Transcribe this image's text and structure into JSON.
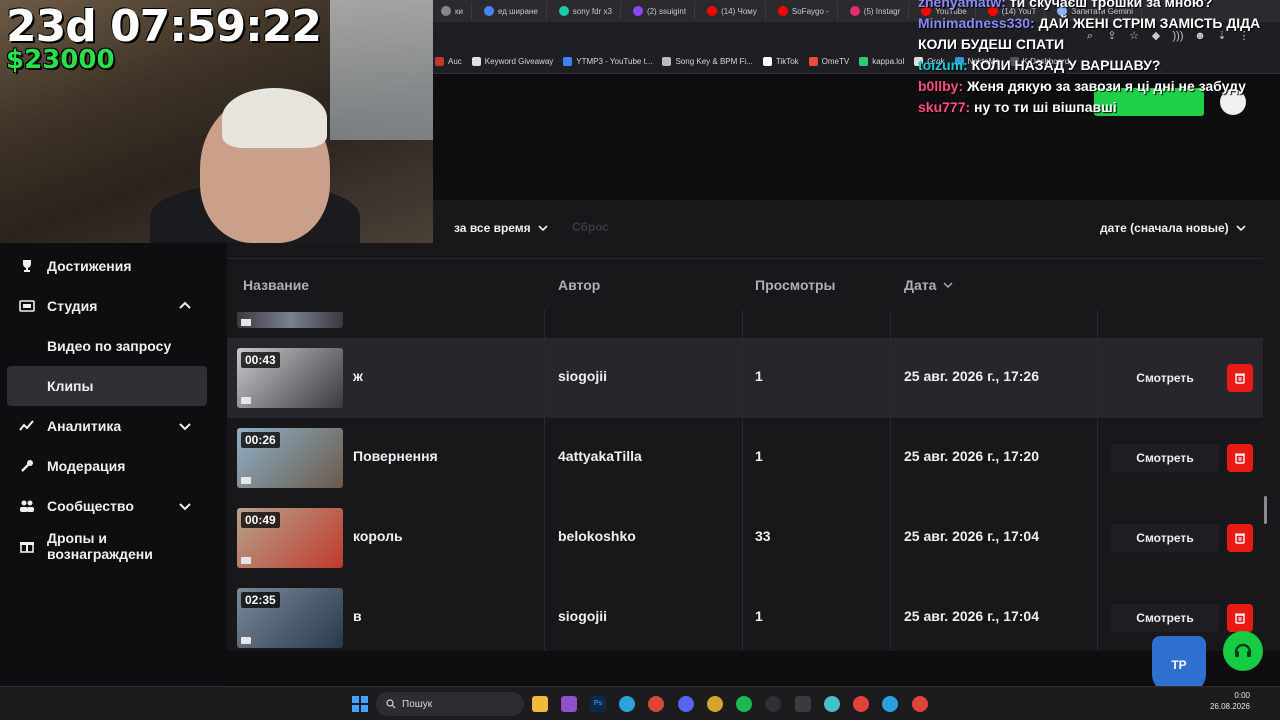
{
  "overlay": {
    "timer": "23d 07:59:22",
    "money": "$23000"
  },
  "browser": {
    "tabs": [
      {
        "label": "ки",
        "color": "#888888"
      },
      {
        "label": "ед ширане",
        "color": "#4285f4"
      },
      {
        "label": "sony fdr x3",
        "color": "#1dc8a8"
      },
      {
        "label": "(2) ssuigint",
        "color": "#9146ff"
      },
      {
        "label": "(14) Чому",
        "color": "#ff0000"
      },
      {
        "label": "SoFaygo -",
        "color": "#ff0000"
      },
      {
        "label": "(5) Instagr",
        "color": "#e1306c"
      },
      {
        "label": "YouTube",
        "color": "#ff0000"
      },
      {
        "label": "(14) YouT",
        "color": "#ff0000"
      },
      {
        "label": "Запитати Gemini",
        "color": "#8ab4f8"
      }
    ],
    "bookmarks": [
      {
        "label": "Auc",
        "color": "#c0392b"
      },
      {
        "label": "Keyword Giveaway",
        "color": "#e0e0e0"
      },
      {
        "label": "YTMP3 - YouTube t...",
        "color": "#3b82f6"
      },
      {
        "label": "Song Key & BPM Fi...",
        "color": "#bbbbbb"
      },
      {
        "label": "TikTok",
        "color": "#ffffff"
      },
      {
        "label": "OmeTV",
        "color": "#e74c3c"
      },
      {
        "label": "kappa.lol",
        "color": "#2ecc71"
      },
      {
        "label": "Grok",
        "color": "#dddddd"
      },
      {
        "label": "NektoMe",
        "color": "#3498db"
      },
      {
        "label": "K Dashboard",
        "color": "#555555"
      }
    ]
  },
  "chat": [
    {
      "user": "zhenyamatw:",
      "color": "#8a8aff",
      "message": "ти скучаєш трошки за мною?"
    },
    {
      "user": "Minimadness330:",
      "color": "#8a8aff",
      "message": "ДАЙ ЖЕНІ СТРІМ ЗАМІСТЬ ДІДА КОЛИ БУДЕШ СПАТИ"
    },
    {
      "user": "toizum:",
      "color": "#1ec8d6",
      "message": "КОЛИ НАЗАД У ВАРШАВУ?"
    },
    {
      "user": "b0llby:",
      "color": "#ff4f7a",
      "message": "Женя дякую за завози я ці дні не забуду"
    },
    {
      "user": "sku777:",
      "color": "#ff4f7a",
      "message": "ну то ти ші вішпавші"
    }
  ],
  "sidebar": {
    "items": [
      {
        "label": "Достижения",
        "icon": "trophy-icon"
      },
      {
        "label": "Студия",
        "icon": "film-icon",
        "expanded": true
      },
      {
        "label": "Видео по запросу",
        "sub": true
      },
      {
        "label": "Клипы",
        "sub": true,
        "active": true
      },
      {
        "label": "Аналитика",
        "icon": "chart-icon",
        "expanded": false
      },
      {
        "label": "Модерация",
        "icon": "wrench-icon"
      },
      {
        "label": "Сообщество",
        "icon": "people-icon",
        "expanded": false
      },
      {
        "label": "Дропы и вознаграждени",
        "icon": "gift-icon"
      }
    ]
  },
  "filters": {
    "period": "за все время",
    "reset": "Сброс",
    "sort": "дате (сначала новые)"
  },
  "table": {
    "headers": {
      "name": "Название",
      "author": "Автор",
      "views": "Просмотры",
      "date": "Дата"
    },
    "rows": [
      {
        "duration": "00:43",
        "title": "ж",
        "author": "siogojii",
        "views": "1",
        "date": "25 авг. 2026 г., 17:26",
        "action": "Смотреть",
        "colors": [
          "#c9c9cc",
          "#3a3a40"
        ]
      },
      {
        "duration": "00:26",
        "title": "Повернення",
        "author": "4attyakaTilla",
        "views": "1",
        "date": "25 авг. 2026 г., 17:20",
        "action": "Смотреть",
        "colors": [
          "#8fb0c8",
          "#6a5a4a"
        ]
      },
      {
        "duration": "00:49",
        "title": "король",
        "author": "belokoshko",
        "views": "33",
        "date": "25 авг. 2026 г., 17:04",
        "action": "Смотреть",
        "colors": [
          "#b5a48c",
          "#c0392b"
        ]
      },
      {
        "duration": "02:35",
        "title": "в",
        "author": "siogojii",
        "views": "1",
        "date": "25 авг. 2026 г., 17:04",
        "action": "Смотреть",
        "colors": [
          "#7a8a99",
          "#2b3a4a"
        ]
      }
    ]
  },
  "taskbar": {
    "search_placeholder": "Пошук",
    "time": "0:00",
    "date": "26.08.2026",
    "badge": "ТР"
  }
}
